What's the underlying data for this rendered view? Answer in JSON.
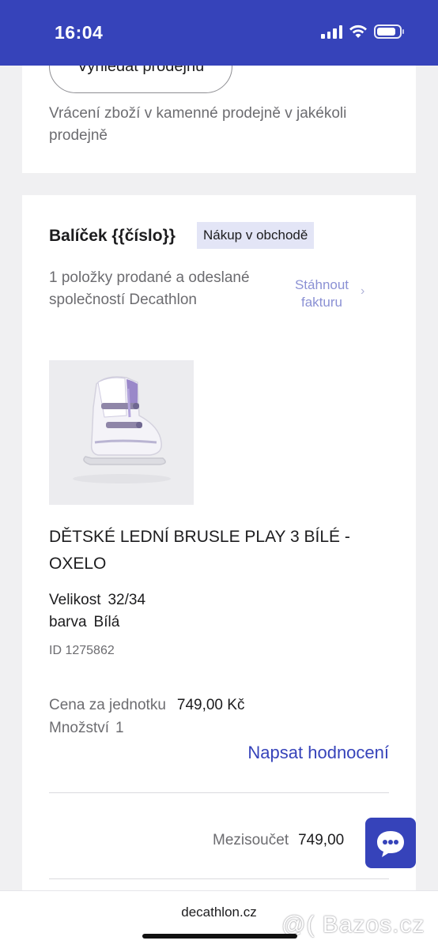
{
  "status_bar": {
    "time": "16:04"
  },
  "top_card": {
    "find_store_label": "Vyhledat prodejnu",
    "return_text": "Vrácení zboží v kamenné prodejně v jakékoli prodejně"
  },
  "package": {
    "title": "Balíček {{číslo}}",
    "badge": "Nákup v obchodě",
    "sold_text": "1 položky prodané a odeslané společností Decathlon",
    "invoice_link": "Stáhnout fakturu",
    "invoice_chevron": "›"
  },
  "product": {
    "name": "DĚTSKÉ LEDNÍ BRUSLE PLAY 3 BÍLÉ - OXELO",
    "size_label": "Velikost",
    "size_value": "32/34",
    "color_label": "barva",
    "color_value": "Bílá",
    "id_text": "ID 1275862",
    "unit_price_label": "Cena za jednotku",
    "unit_price_value": "749,00 Kč",
    "quantity_label": "Množství",
    "quantity_value": "1",
    "review_link": "Napsat hodnocení"
  },
  "summary": {
    "subtotal_label": "Mezisoučet",
    "subtotal_value": "749,00"
  },
  "browser": {
    "domain": "decathlon.cz"
  },
  "watermark": "@( Bazos.cz",
  "colors": {
    "brand_blue": "#3643ba",
    "badge_bg": "#e3e5f6",
    "invoice_link": "#8b91d4"
  }
}
